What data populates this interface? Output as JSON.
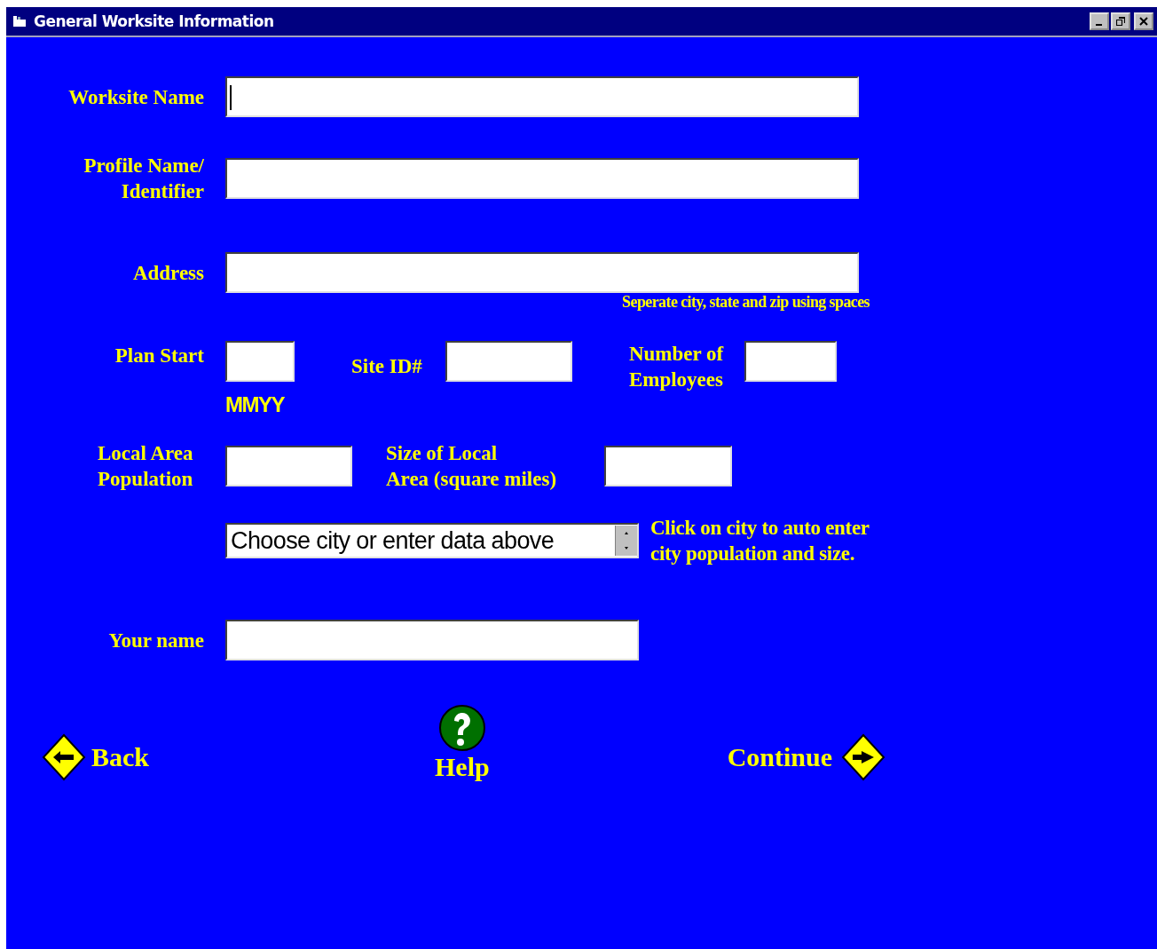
{
  "window": {
    "title": "General Worksite Information"
  },
  "worksite_name": {
    "label": "Worksite Name",
    "focused": true
  },
  "profile_name": {
    "label": "Profile Name/\nIdentifier",
    "focused": false
  },
  "address": {
    "label": "Address",
    "hint": "Seperate city, state and zip using spaces",
    "focused": false
  },
  "plan_start": {
    "label": "Plan Start",
    "format": "MMYY",
    "focused": false
  },
  "site_id": {
    "label": "Site ID#",
    "focused": false
  },
  "employees": {
    "label": "Number of\nEmployees",
    "focused": false
  },
  "local_population": {
    "label": "Local Area\nPopulation",
    "focused": false
  },
  "local_area_size": {
    "label": "Size of Local\nArea (square miles)",
    "focused": false
  },
  "city_select": {
    "value": "Choose city or enter data above",
    "hint": "Click on city to auto enter\ncity population and size."
  },
  "your_name": {
    "label": "Your name",
    "focused": false
  },
  "nav": {
    "back": "Back",
    "help": "Help",
    "continue": "Continue"
  }
}
